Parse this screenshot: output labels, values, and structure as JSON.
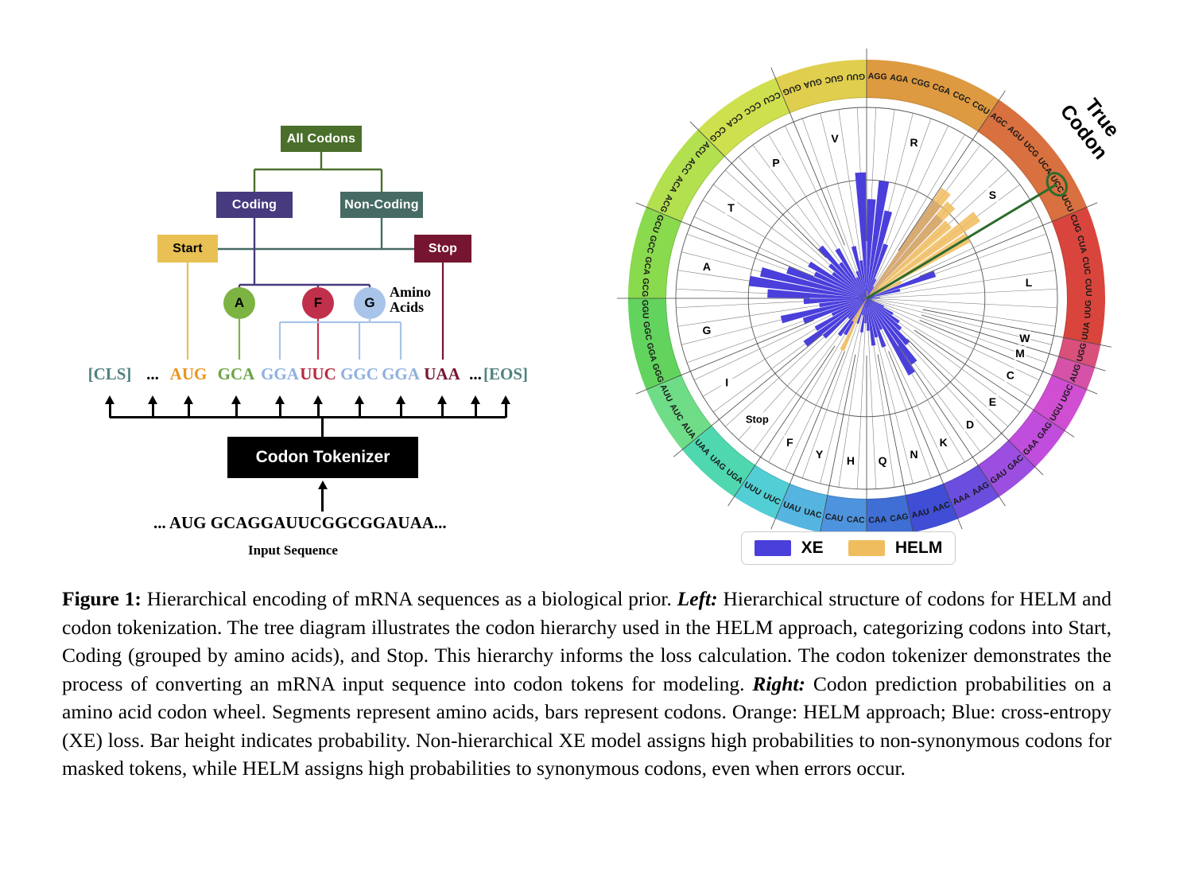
{
  "figure": {
    "caption_number": "Figure 1:",
    "caption": " Hierarchical encoding of mRNA sequences as a biological prior. Left: Hierarchical structure of codons for HELM and codon tokenization. The tree diagram illustrates the codon hierarchy used in the HELM approach, categorizing codons into Start, Coding (grouped by amino acids), and Stop. This hierarchy informs the loss calculation. The codon tokenizer demonstrates the process of converting an mRNA input sequence into codon tokens for modeling. Right: Codon prediction probabilities on a amino acid codon wheel. Segments represent amino acids, bars represent codons. Orange: HELM approach; Blue: cross-entropy (XE) loss. Bar height indicates probability. Non-hierarchical XE model assigns high probabilities to non-synonymous codons for masked tokens, while HELM assigns high probabilities to synonymous codons, even when errors occur.",
    "emph_left": "Left:",
    "emph_right": "Right:"
  },
  "tree": {
    "nodes": [
      {
        "id": "all-codons",
        "label": "All Codons",
        "color": "#4a6f2b",
        "text_color": "#ffffff"
      },
      {
        "id": "coding",
        "label": "Coding",
        "color": "#473a7e",
        "text_color": "#ffffff"
      },
      {
        "id": "non-coding",
        "label": "Non-Coding",
        "color": "#466b64",
        "text_color": "#ffffff"
      },
      {
        "id": "start",
        "label": "Start",
        "color": "#e8c054",
        "text_color": "#000000"
      },
      {
        "id": "stop",
        "label": "Stop",
        "color": "#76152f",
        "text_color": "#ffffff"
      }
    ],
    "amino_acids": [
      {
        "id": "A",
        "label": "A",
        "color": "#7cb342"
      },
      {
        "id": "F",
        "label": "F",
        "color": "#c1304a"
      },
      {
        "id": "G",
        "label": "G",
        "color": "#a8c4e8"
      }
    ],
    "amino_acids_label_line1": "Amino",
    "amino_acids_label_line2": "Acids"
  },
  "tokens": [
    {
      "text": "[CLS]",
      "color": "#4f8280",
      "has_arrow": true,
      "has_link": false
    },
    {
      "text": "...",
      "color": "#000000",
      "has_arrow": true,
      "has_link": false
    },
    {
      "text": "AUG",
      "color": "#e8951e",
      "has_arrow": true,
      "has_link": true,
      "link_color": "#e8c054"
    },
    {
      "text": "GCA",
      "color": "#6aa344",
      "has_arrow": true,
      "has_link": true,
      "link_color": "#7cb342"
    },
    {
      "text": "GGA",
      "color": "#8fb0e0",
      "has_arrow": true,
      "has_link": true,
      "link_color": "#a8c4e8"
    },
    {
      "text": "UUC",
      "color": "#b42a40",
      "has_arrow": true,
      "has_link": true,
      "link_color": "#c1304a"
    },
    {
      "text": "GGC",
      "color": "#8fb0e0",
      "has_arrow": true,
      "has_link": true,
      "link_color": "#a8c4e8"
    },
    {
      "text": "GGA",
      "color": "#8fb0e0",
      "has_arrow": true,
      "has_link": true,
      "link_color": "#a8c4e8"
    },
    {
      "text": "UAA",
      "color": "#76152f",
      "has_arrow": true,
      "has_link": true,
      "link_color": "#76152f"
    },
    {
      "text": "...",
      "color": "#000000",
      "has_arrow": true,
      "has_link": false
    },
    {
      "text": "[EOS]",
      "color": "#4f8280",
      "has_arrow": true,
      "has_link": false
    }
  ],
  "tokenizer": {
    "label": "Codon Tokenizer",
    "input_sequence": "... AUG GCAGGAUUCGGCGGAUAA...",
    "input_label": "Input Sequence"
  },
  "wheel": {
    "true_codon_label_line1": "True",
    "true_codon_label_line2": "Codon",
    "true_codon": "UCC",
    "true_codon_highlight_color": "#2d6b2d",
    "stop_label": "Stop"
  },
  "legend": {
    "items": [
      {
        "label": "XE",
        "color": "#4a3fdb"
      },
      {
        "label": "HELM",
        "color": "#f0bd5e"
      }
    ]
  },
  "chart_data": {
    "type": "bar",
    "subtype": "polar-rose-codon-wheel",
    "title": "Codon prediction probabilities on a amino acid codon wheel",
    "angular_axis": "codon (64 codons grouped into 21 amino-acid segments)",
    "radial_axis": "probability",
    "rlim": [
      0,
      1
    ],
    "grid": true,
    "legend_position": "bottom",
    "start_angle_deg": 90,
    "direction": "clockwise",
    "series": [
      {
        "name": "XE",
        "color": "#4a3fdb"
      },
      {
        "name": "HELM",
        "color": "#f0bd5e"
      }
    ],
    "groups": [
      {
        "aa": "R",
        "color": "#dd9a41",
        "codons": [
          "AGG",
          "AGA",
          "CGG",
          "CGA",
          "CGC",
          "CGU"
        ],
        "XE": [
          0.52,
          0.62,
          0.47,
          0.3,
          0.11,
          0.07
        ],
        "HELM": [
          0.04,
          0.03,
          0.02,
          0.02,
          0.01,
          0.01
        ]
      },
      {
        "aa": "S",
        "color": "#d9703f",
        "codons": [
          "AGC",
          "AGU",
          "UCG",
          "UCA",
          "UCC",
          "UCU"
        ],
        "XE": [
          0.62,
          0.57,
          0.08,
          0.06,
          0.05,
          0.04
        ],
        "HELM": [
          0.7,
          0.66,
          0.58,
          0.72,
          0.62,
          0.2
        ]
      },
      {
        "aa": "L",
        "color": "#d9453c",
        "codons": [
          "CUG",
          "CUA",
          "CUC",
          "CUU",
          "UUG",
          "UUA"
        ],
        "XE": [
          0.38,
          0.18,
          0.04,
          0.07,
          0.03,
          0.02
        ],
        "HELM": [
          0.01,
          0.01,
          0.01,
          0.01,
          0.0,
          0.0
        ]
      },
      {
        "aa": "W",
        "color": "#d9507b",
        "codons": [
          "UGG"
        ],
        "XE": [
          0.02
        ],
        "HELM": [
          0.0
        ]
      },
      {
        "aa": "M",
        "color": "#d652a8",
        "codons": [
          "AUG"
        ],
        "XE": [
          0.03
        ],
        "HELM": [
          0.0
        ]
      },
      {
        "aa": "C",
        "color": "#cf4ed1",
        "codons": [
          "UGC",
          "UGU"
        ],
        "XE": [
          0.1,
          0.16
        ],
        "HELM": [
          0.0,
          0.0
        ]
      },
      {
        "aa": "E",
        "color": "#c14ddd",
        "codons": [
          "GAG",
          "GAA"
        ],
        "XE": [
          0.21,
          0.24
        ],
        "HELM": [
          0.0,
          0.0
        ]
      },
      {
        "aa": "D",
        "color": "#9b4ee0",
        "codons": [
          "GAC",
          "GAU"
        ],
        "XE": [
          0.32,
          0.42
        ],
        "HELM": [
          0.0,
          0.0
        ]
      },
      {
        "aa": "K",
        "color": "#6b4edd",
        "codons": [
          "AAG",
          "AAA"
        ],
        "XE": [
          0.46,
          0.18
        ],
        "HELM": [
          0.0,
          0.0
        ]
      },
      {
        "aa": "N",
        "color": "#3f4ed4",
        "codons": [
          "AAC",
          "AAU"
        ],
        "XE": [
          0.27,
          0.21
        ],
        "HELM": [
          0.0,
          0.0
        ]
      },
      {
        "aa": "Q",
        "color": "#3f6ed4",
        "codons": [
          "CAG",
          "CAA"
        ],
        "XE": [
          0.25,
          0.17
        ],
        "HELM": [
          0.0,
          0.0
        ]
      },
      {
        "aa": "H",
        "color": "#4e93de",
        "codons": [
          "CAC",
          "CAU"
        ],
        "XE": [
          0.13,
          0.18
        ],
        "HELM": [
          0.0,
          0.0
        ]
      },
      {
        "aa": "Y",
        "color": "#55b5e0",
        "codons": [
          "UAC",
          "UAU"
        ],
        "XE": [
          0.09,
          0.14
        ],
        "HELM": [
          0.02,
          0.0
        ]
      },
      {
        "aa": "F",
        "color": "#52cfd4",
        "codons": [
          "UUC",
          "UUU"
        ],
        "XE": [
          0.06,
          0.22
        ],
        "HELM": [
          0.3,
          0.14
        ]
      },
      {
        "aa": "Stop",
        "color": "#4fd8b0",
        "codons": [
          "UGA",
          "UAG",
          "UAA"
        ],
        "XE": [
          0.24,
          0.14,
          0.3
        ],
        "HELM": [
          0.0,
          0.0,
          0.0
        ]
      },
      {
        "aa": "I",
        "color": "#6fdd88",
        "codons": [
          "AUA",
          "AUC",
          "AUU"
        ],
        "XE": [
          0.4,
          0.31,
          0.2
        ],
        "HELM": [
          0.0,
          0.0,
          0.0
        ]
      },
      {
        "aa": "G",
        "color": "#62d45e",
        "codons": [
          "GGG",
          "GGA",
          "GGC",
          "GGU"
        ],
        "XE": [
          0.35,
          0.46,
          0.25,
          0.33
        ],
        "HELM": [
          0.0,
          0.0,
          0.0,
          0.0
        ]
      },
      {
        "aa": "A",
        "color": "#8ada4e",
        "codons": [
          "GCG",
          "GCA",
          "GCC",
          "GCU"
        ],
        "XE": [
          0.52,
          0.62,
          0.57,
          0.44
        ],
        "HELM": [
          0.02,
          0.01,
          0.01,
          0.01
        ]
      },
      {
        "aa": "T",
        "color": "#b3e04e",
        "codons": [
          "ACG",
          "ACA",
          "ACC",
          "ACU"
        ],
        "XE": [
          0.3,
          0.35,
          0.22,
          0.26
        ],
        "HELM": [
          0.0,
          0.0,
          0.0,
          0.0
        ]
      },
      {
        "aa": "P",
        "color": "#cfe04e",
        "codons": [
          "CCG",
          "CCA",
          "CCC",
          "CCU"
        ],
        "XE": [
          0.36,
          0.23,
          0.3,
          0.12
        ],
        "HELM": [
          0.01,
          0.0,
          0.0,
          0.0
        ]
      },
      {
        "aa": "V",
        "color": "#e0cf4e",
        "codons": [
          "GUG",
          "GUA",
          "GUC",
          "GUU"
        ],
        "XE": [
          0.15,
          0.28,
          0.2,
          0.66
        ],
        "HELM": [
          0.0,
          0.0,
          0.0,
          0.0
        ]
      }
    ]
  }
}
